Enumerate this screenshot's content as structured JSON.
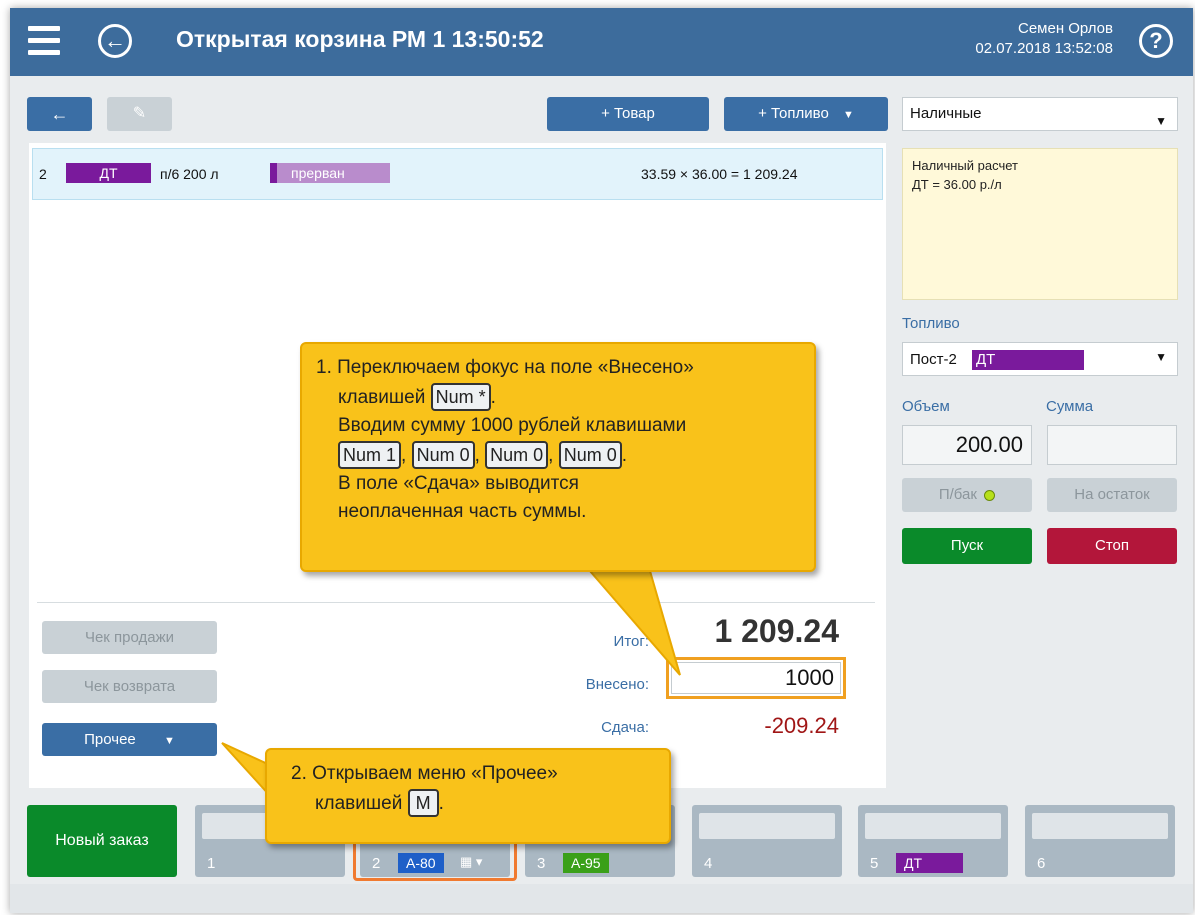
{
  "header": {
    "title": "Открытая корзина  РМ 1  13:50:52",
    "user": "Семен Орлов",
    "datetime": "02.07.2018 13:52:08"
  },
  "toolbar": {
    "back_symbol": "←",
    "edit_symbol": "✎",
    "add_goods": "+ Товар",
    "add_fuel": "+ Топливо"
  },
  "basket": {
    "items": [
      {
        "index": "2",
        "fuel": "ДТ",
        "dispenser": "п/6 200 л",
        "status": "прерван",
        "calc": "33.59 × 36.00 = 1 209.24"
      }
    ]
  },
  "totals": {
    "total_label": "Итог:",
    "total_value": "1 209.24",
    "paid_label": "Внесено:",
    "paid_value": "1000",
    "change_label": "Сдача:",
    "change_value": "-209.24"
  },
  "actions": {
    "sale_receipt": "Чек продажи",
    "return_receipt": "Чек возврата",
    "other": "Прочее"
  },
  "payment": {
    "method": "Наличные",
    "note_line1": "Наличный расчет",
    "note_line2": "ДТ = 36.00 р./л"
  },
  "fuel_panel": {
    "section_label": "Топливо",
    "pump_label": "Пост-2",
    "fuel": "ДТ",
    "volume_label": "Объем",
    "sum_label": "Сумма",
    "volume_value": "200.00",
    "sum_value": "",
    "full_tank": "П/бак",
    "remainder": "На остаток",
    "start": "Пуск",
    "stop": "Стоп"
  },
  "bottom": {
    "new_order": "Новый заказ",
    "pumps": [
      {
        "num": "1",
        "fuel": ""
      },
      {
        "num": "2",
        "fuel": "А-80"
      },
      {
        "num": "3",
        "fuel": "А-95"
      },
      {
        "num": "4",
        "fuel": ""
      },
      {
        "num": "5",
        "fuel": "ДТ"
      },
      {
        "num": "6",
        "fuel": ""
      }
    ]
  },
  "callouts": {
    "c1_line1": "1. Переключаем фокус на поле «Внесено»",
    "c1_line2a": "клавишей",
    "c1_key_star": "Num *",
    "c1_line3": "Вводим сумму 1000 рублей клавишами",
    "c1_key1": "Num 1",
    "c1_key0": "Num 0",
    "c1_line4": "В поле «Сдача» выводится",
    "c1_line5": "неоплаченная часть суммы.",
    "c2_line1": "2. Открываем меню «Прочее»",
    "c2_line2a": "клавишей",
    "c2_key": "M"
  },
  "colors": {
    "header": "#3d6c9c",
    "button_blue": "#3a6ea5",
    "fuel_dt": "#7a1a9c",
    "status_aborted": "#b98ccc",
    "fuel_a80": "#1e5fc8",
    "fuel_a95": "#3aa019",
    "start": "#0a8a2a",
    "stop": "#b3163a",
    "callout": "#f9c21a",
    "highlight": "#f0a020"
  }
}
